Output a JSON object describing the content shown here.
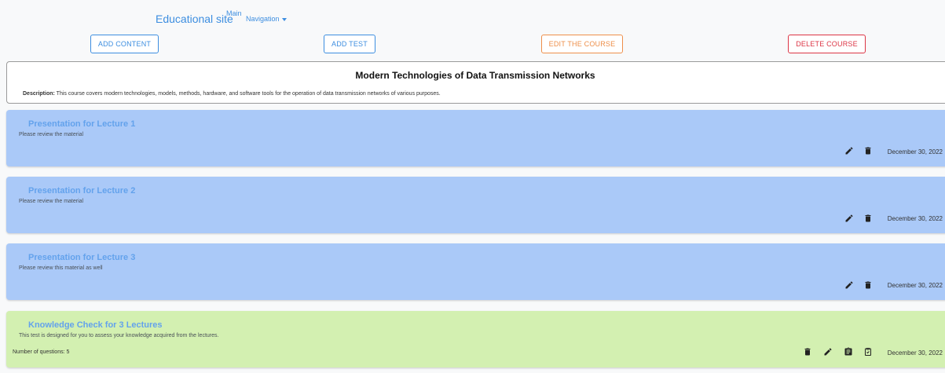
{
  "nav": {
    "brand": "Educational site",
    "main": "Main",
    "navigation": "Navigation"
  },
  "actions": {
    "add_content": "ADD CONTENT",
    "add_test": "ADD TEST",
    "edit_course": "EDIT THE COURSE",
    "delete_course": "DELETE COURSE"
  },
  "course": {
    "title": "Modern Technologies of Data Transmission Networks",
    "description_label": "Description:",
    "description": "This course covers modern technologies, models, methods, hardware, and software tools for the operation of data transmission networks of various purposes."
  },
  "items": [
    {
      "title": "Presentation for Lecture 1",
      "subtitle": "Please review the material",
      "date": "December 30, 2022",
      "icons": [
        "pencil-icon",
        "trash-icon"
      ]
    },
    {
      "title": "Presentation for Lecture 2",
      "subtitle": "Please review the material",
      "date": "December 30, 2022",
      "icons": [
        "pencil-icon",
        "trash-icon"
      ]
    },
    {
      "title": "Presentation for Lecture 3",
      "subtitle": "Please review this material as well",
      "date": "December 30, 2022",
      "icons": [
        "pencil-icon",
        "trash-icon"
      ]
    },
    {
      "title": "Knowledge Check for 3 Lectures",
      "subtitle": "This test is designed for you to assess your knowledge acquired from the lectures.",
      "meta": "Number of questions: 5",
      "date": "December 30, 2022",
      "icons": [
        "trash-icon",
        "pencil-icon",
        "clipboard-list-icon",
        "clipboard-check-icon"
      ]
    }
  ],
  "colors": {
    "lecture_bg": "#aac9f8",
    "test_bg": "#d3f0b1",
    "accent": "#3d8ee0",
    "edit": "#ee8f4a",
    "danger": "#dc3545"
  }
}
